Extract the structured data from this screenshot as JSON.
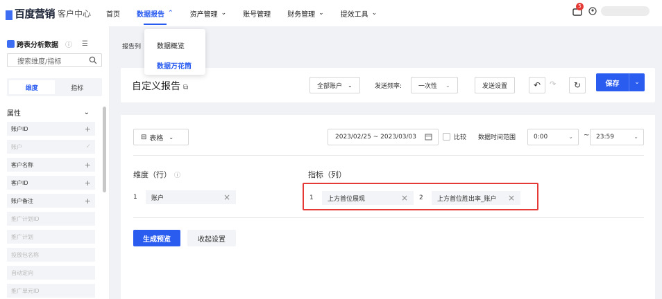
{
  "brand": {
    "name": "百度营销",
    "subtitle": "客户中心"
  },
  "nav": {
    "items": [
      {
        "label": "首页",
        "has_dropdown": false
      },
      {
        "label": "数据报告",
        "has_dropdown": true,
        "active": true
      },
      {
        "label": "资产管理",
        "has_dropdown": true
      },
      {
        "label": "账号管理",
        "has_dropdown": false
      },
      {
        "label": "财务管理",
        "has_dropdown": true
      },
      {
        "label": "提效工具",
        "has_dropdown": true
      }
    ],
    "message_badge": "5"
  },
  "dropdown": {
    "items": [
      {
        "label": "数据概览"
      },
      {
        "label": "数据万花筒",
        "selected": true
      }
    ]
  },
  "sidebar": {
    "title": "跨表分析数据",
    "search_placeholder": "搜索维度/指标",
    "tabs": [
      {
        "label": "维度",
        "active": true
      },
      {
        "label": "指标"
      }
    ],
    "section_label": "属性",
    "rows": [
      {
        "label": "账户ID",
        "action": "+",
        "dim": false
      },
      {
        "label": "账户",
        "action": "✓",
        "dim": true
      },
      {
        "label": "客户名称",
        "action": "+",
        "dim": false
      },
      {
        "label": "客户ID",
        "action": "+",
        "dim": false
      },
      {
        "label": "账户备注",
        "action": "+",
        "dim": false
      },
      {
        "label": "推广计划ID",
        "action": "",
        "dim": true
      },
      {
        "label": "推广计划",
        "action": "",
        "dim": true
      },
      {
        "label": "投放包名称",
        "action": "",
        "dim": true
      },
      {
        "label": "自动定向",
        "action": "",
        "dim": true
      },
      {
        "label": "推广单元ID",
        "action": "",
        "dim": true
      }
    ]
  },
  "report_list_label": "报告列",
  "header": {
    "title": "自定义报告",
    "account_select": "全部账户",
    "freq_label": "发送频率:",
    "freq_value": "一次性",
    "send_settings": "发送设置",
    "save": "保存"
  },
  "main": {
    "view_select": "表格",
    "date_range": "2023/02/25 ~ 2023/03/03",
    "compare_label": "比较",
    "time_range_label": "数据时间范围",
    "time_start": "0:00",
    "time_tilde": "~",
    "time_end": "23:59",
    "dimension_label": "维度（行）",
    "metric_label": "指标（列）",
    "dimensions": [
      {
        "num": "1",
        "label": "账户"
      }
    ],
    "metrics": [
      {
        "num": "1",
        "label": "上方首位展现"
      },
      {
        "num": "2",
        "label": "上方首位胜出率_账户"
      }
    ],
    "generate_preview": "生成预览",
    "fold_settings": "收起设置"
  },
  "colors": {
    "accent": "#2a5cf0",
    "highlight_border": "#e53935"
  }
}
